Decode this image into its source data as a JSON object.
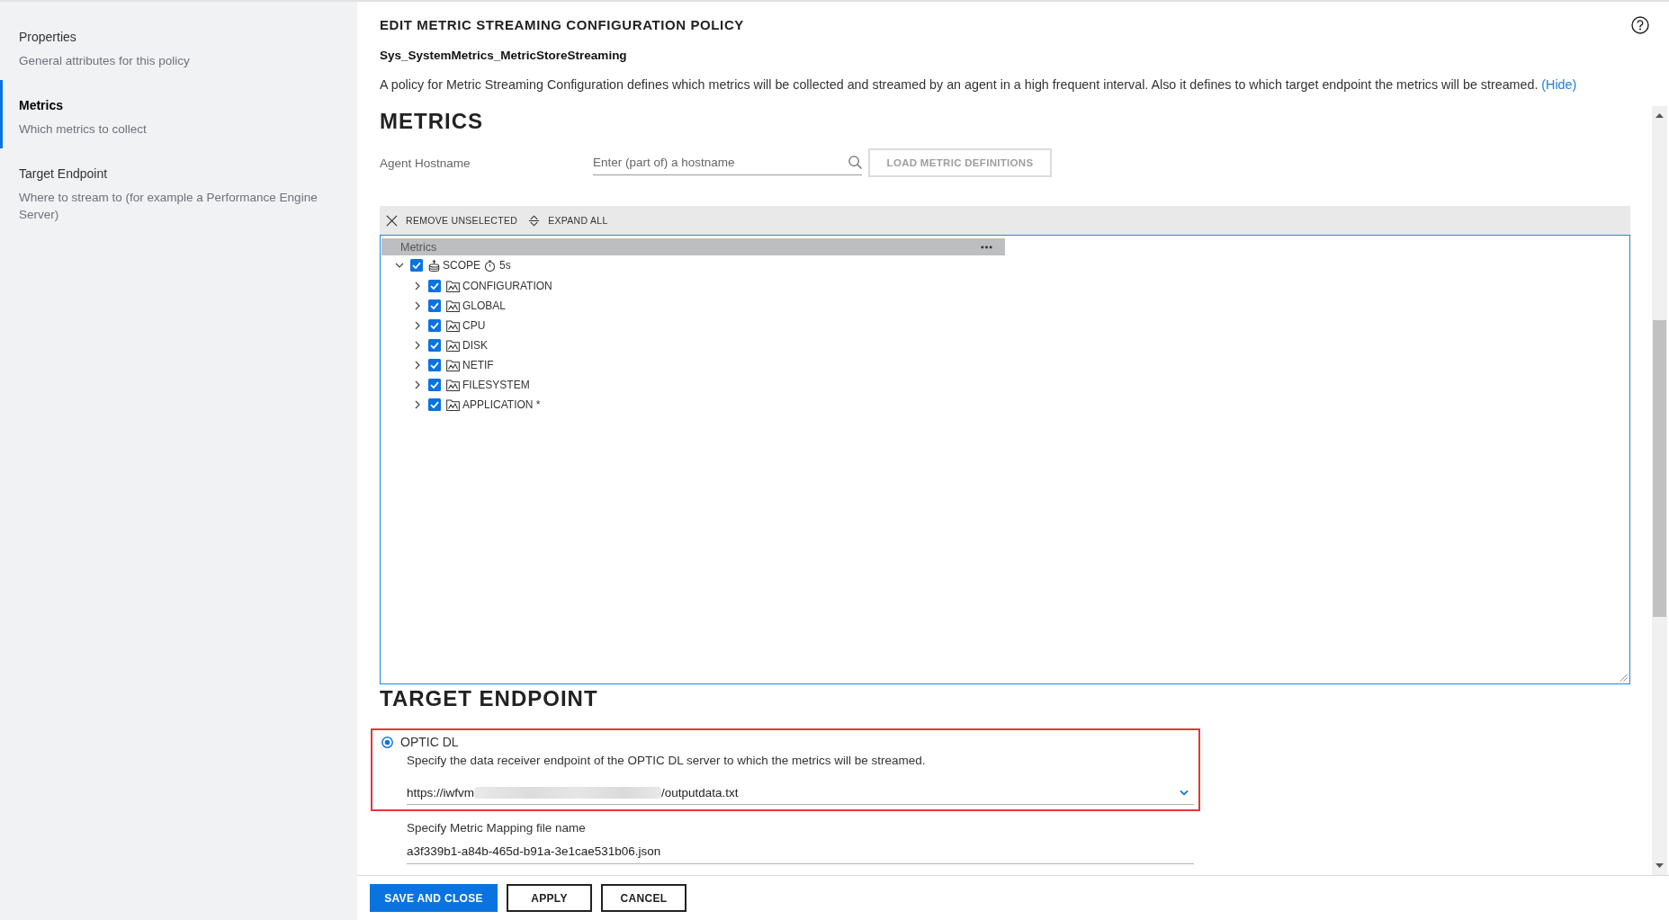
{
  "sidebar": {
    "items": [
      {
        "title": "Properties",
        "subtitle": "General attributes for this policy",
        "selected": false
      },
      {
        "title": "Metrics",
        "subtitle": "Which metrics to collect",
        "selected": true
      },
      {
        "title": "Target Endpoint",
        "subtitle": "Where to stream to (for example a Performance Engine Server)",
        "selected": false
      }
    ]
  },
  "header": {
    "title": "EDIT METRIC STREAMING CONFIGURATION POLICY",
    "policy_name": "Sys_SystemMetrics_MetricStoreStreaming",
    "description": "A policy for Metric Streaming Configuration defines which metrics will be collected and streamed by an agent in a high frequent interval. Also it defines to which target endpoint the metrics will be streamed.",
    "description_link": "(Hide)"
  },
  "metrics": {
    "heading": "METRICS",
    "agent_hostname": {
      "label": "Agent Hostname",
      "placeholder": "Enter (part of) a hostname"
    },
    "load_button": {
      "label": "LOAD METRIC DEFINITIONS",
      "disabled": true
    },
    "toolbar": [
      {
        "kind": "remove",
        "label": "REMOVE UNSELECTED"
      },
      {
        "kind": "expand",
        "label": "EXPAND ALL"
      }
    ],
    "tree": {
      "column": "Metrics",
      "nodes": [
        {
          "kind": "scope",
          "label": "SCOPE",
          "interval": "5s",
          "checked": true,
          "expanded": true,
          "children": [
            {
              "kind": "metric_class",
              "label": "CONFIGURATION",
              "checked": true,
              "expanded": false
            },
            {
              "kind": "metric_class",
              "label": "GLOBAL",
              "checked": true,
              "expanded": false
            },
            {
              "kind": "metric_class",
              "label": "CPU",
              "checked": true,
              "expanded": false
            },
            {
              "kind": "metric_class",
              "label": "DISK",
              "checked": true,
              "expanded": false
            },
            {
              "kind": "metric_class",
              "label": "NETIF",
              "checked": true,
              "expanded": false
            },
            {
              "kind": "metric_class",
              "label": "FILESYSTEM",
              "checked": true,
              "expanded": false
            },
            {
              "kind": "metric_class",
              "label": "APPLICATION *",
              "checked": true,
              "expanded": false
            }
          ]
        }
      ]
    }
  },
  "target_endpoint": {
    "heading": "TARGET ENDPOINT",
    "options": [
      {
        "label": "OPTIC DL",
        "selected": true,
        "highlighted": true,
        "description": "Specify the data receiver endpoint of the OPTIC DL server to which the metrics will be streamed.",
        "endpoint": {
          "prefix": "https://iwfvm",
          "suffix": "/outputdata.txt",
          "redacted": true
        }
      }
    ],
    "mapping_file": {
      "label": "Specify Metric Mapping file name",
      "value": "a3f339b1-a84b-465d-b91a-3e1cae531b06.json"
    }
  },
  "footer": {
    "buttons": [
      {
        "kind": "save",
        "label": "SAVE AND CLOSE"
      },
      {
        "kind": "apply",
        "label": "APPLY"
      },
      {
        "kind": "cancel",
        "label": "CANCEL"
      }
    ]
  }
}
